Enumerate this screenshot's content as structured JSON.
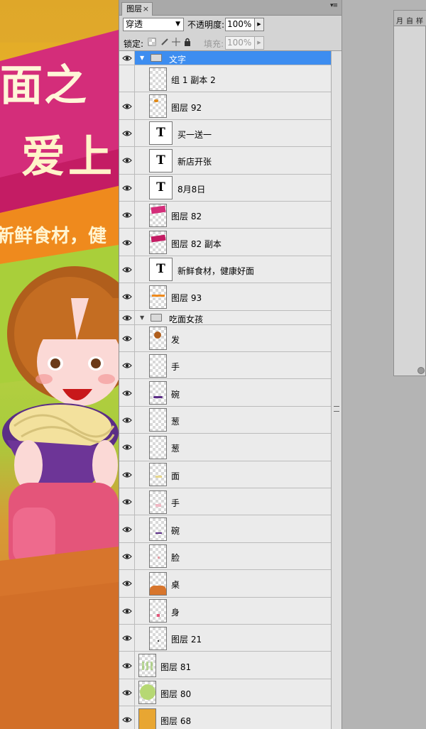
{
  "canvas": {
    "headline_line1": "面之",
    "headline_line2": "爱上",
    "tagline": "新鲜食材，健"
  },
  "panel": {
    "tab_label": "图层",
    "close_glyph": "×",
    "menu_glyph": "▾≡",
    "blend_mode": "穿透",
    "opacity_label": "不透明度:",
    "opacity_value": "100%",
    "lock_label": "锁定:",
    "fill_label": "填充:",
    "fill_value": "100%"
  },
  "layers": [
    {
      "name": "文字",
      "kind": "group",
      "indent": 0,
      "selected": true,
      "visible": true
    },
    {
      "name": "组 1 副本 2",
      "kind": "layer",
      "indent": 1,
      "visible": false,
      "thumb": "blank"
    },
    {
      "name": "图层 92",
      "kind": "layer",
      "indent": 1,
      "visible": true,
      "thumb": "dot-orange"
    },
    {
      "name": "买一送一",
      "kind": "text",
      "indent": 1,
      "visible": true
    },
    {
      "name": "新店开张",
      "kind": "text",
      "indent": 1,
      "visible": true
    },
    {
      "name": "8月8日",
      "kind": "text",
      "indent": 1,
      "visible": true
    },
    {
      "name": "图层 82",
      "kind": "layer",
      "indent": 1,
      "visible": true,
      "thumb": "banner-pink"
    },
    {
      "name": "图层 82 副本",
      "kind": "layer",
      "indent": 1,
      "visible": true,
      "thumb": "banner-pink2"
    },
    {
      "name": "新鲜食材，健康好面",
      "kind": "text",
      "indent": 1,
      "visible": true
    },
    {
      "name": "图层 93",
      "kind": "layer",
      "indent": 1,
      "visible": true,
      "thumb": "stroke-orange"
    },
    {
      "name": "吃面女孩",
      "kind": "group",
      "indent": 0,
      "selected": false,
      "visible": true
    },
    {
      "name": "发",
      "kind": "layer",
      "indent": 1,
      "visible": true,
      "thumb": "hair"
    },
    {
      "name": "手",
      "kind": "layer",
      "indent": 1,
      "visible": true,
      "thumb": "blank"
    },
    {
      "name": "碗",
      "kind": "layer",
      "indent": 1,
      "visible": true,
      "thumb": "bowl"
    },
    {
      "name": "葱",
      "kind": "layer",
      "indent": 1,
      "visible": true,
      "thumb": "blank"
    },
    {
      "name": "葱",
      "kind": "layer",
      "indent": 1,
      "visible": true,
      "thumb": "blank"
    },
    {
      "name": "面",
      "kind": "layer",
      "indent": 1,
      "visible": true,
      "thumb": "noodle"
    },
    {
      "name": "手",
      "kind": "layer",
      "indent": 1,
      "visible": true,
      "thumb": "hand"
    },
    {
      "name": "碗",
      "kind": "layer",
      "indent": 1,
      "visible": true,
      "thumb": "bowl2"
    },
    {
      "name": "脸",
      "kind": "layer",
      "indent": 1,
      "visible": true,
      "thumb": "face"
    },
    {
      "name": "桌",
      "kind": "layer",
      "indent": 1,
      "visible": true,
      "thumb": "table"
    },
    {
      "name": "身",
      "kind": "layer",
      "indent": 1,
      "visible": true,
      "thumb": "body"
    },
    {
      "name": "图层 21",
      "kind": "layer",
      "indent": 1,
      "visible": true,
      "thumb": "dots"
    },
    {
      "name": "图层 81",
      "kind": "layer",
      "indent": 0,
      "visible": true,
      "thumb": "green-pattern"
    },
    {
      "name": "图层 80",
      "kind": "layer",
      "indent": 0,
      "visible": true,
      "thumb": "green-round"
    },
    {
      "name": "图层 68",
      "kind": "layer",
      "indent": 0,
      "visible": true,
      "thumb": "solid-orange"
    }
  ],
  "right_panel": {
    "tabs": [
      "月",
      "自",
      "样"
    ]
  },
  "colors": {
    "selection": "#3d8df0",
    "panel_bg": "#ebebeb",
    "headline_pink": "#d62b78"
  }
}
